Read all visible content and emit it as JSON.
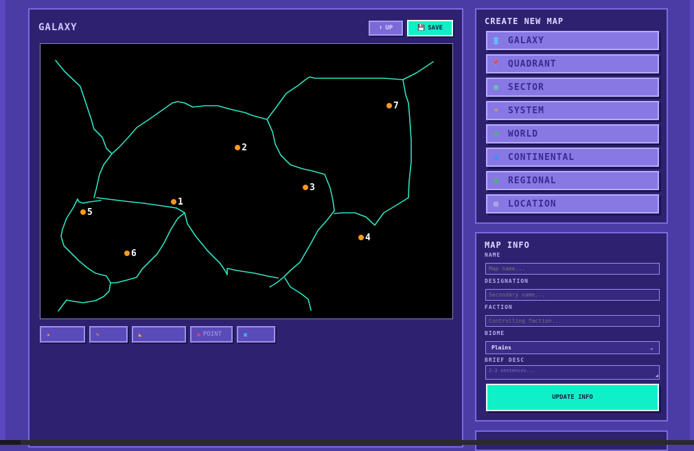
{
  "map": {
    "title": "GALAXY",
    "up_label": "UP",
    "up_icon": "arrow-up-icon",
    "save_label": "SAVE",
    "save_icon": "floppy-disk-icon",
    "accent_color": "#10f0c8",
    "border_color": "#2ee6c4",
    "point_color": "#ff9a1a",
    "points": [
      {
        "label": "1"
      },
      {
        "label": "2"
      },
      {
        "label": "3"
      },
      {
        "label": "4"
      },
      {
        "label": "5"
      },
      {
        "label": "6"
      },
      {
        "label": "7"
      }
    ]
  },
  "toolbar": {
    "tools": [
      {
        "name": "select-tool",
        "icon": "star-icon",
        "label": ""
      },
      {
        "name": "draw-tool",
        "icon": "pencil-icon",
        "label": ""
      },
      {
        "name": "measure-tool",
        "icon": "triangle-ruler-icon",
        "label": ""
      },
      {
        "name": "point-tool",
        "icon": "pin-icon",
        "label": "POINT"
      },
      {
        "name": "image-tool",
        "icon": "picture-icon",
        "label": ""
      }
    ]
  },
  "create_map": {
    "title": "CREATE NEW MAP",
    "items": [
      {
        "label": "GALAXY",
        "icon": "galaxy-icon"
      },
      {
        "label": "QUADRANT",
        "icon": "pin-icon"
      },
      {
        "label": "SECTOR",
        "icon": "map-icon"
      },
      {
        "label": "SYSTEM",
        "icon": "sun-icon"
      },
      {
        "label": "WORLD",
        "icon": "globe-icon"
      },
      {
        "label": "CONTINENTAL",
        "icon": "continent-icon"
      },
      {
        "label": "REGIONAL",
        "icon": "region-icon"
      },
      {
        "label": "LOCATION",
        "icon": "building-icon"
      }
    ]
  },
  "map_info": {
    "title": "MAP INFO",
    "name_label": "NAME",
    "name_placeholder": "Map name...",
    "designation_label": "DESIGNATION",
    "designation_placeholder": "Secondary name...",
    "faction_label": "FACTION",
    "faction_placeholder": "Controlling faction...",
    "biome_label": "BIOME",
    "biome_value": "Plains",
    "brief_label": "BRIEF DESC",
    "brief_placeholder": "2-3 sentences...",
    "update_label": "UPDATE INFO"
  }
}
